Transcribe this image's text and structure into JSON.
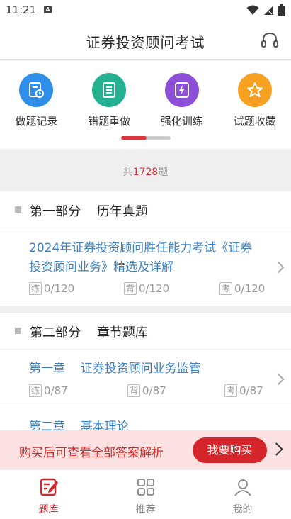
{
  "status": {
    "time": "11:21",
    "notif_icon": "a-notification-icon"
  },
  "header": {
    "title": "证券投资顾问考试",
    "right_icon": "headset-icon"
  },
  "features": [
    {
      "label": "做题记录",
      "icon": "record-icon",
      "color": "#2f8fe8"
    },
    {
      "label": "错题重做",
      "icon": "list-icon",
      "color": "#24b192"
    },
    {
      "label": "强化训练",
      "icon": "lightning-icon",
      "color": "#8e4fd8"
    },
    {
      "label": "试题收藏",
      "icon": "star-icon",
      "color": "#f7a122"
    }
  ],
  "total": {
    "prefix": "共",
    "count": "1728",
    "suffix": "题"
  },
  "sections": [
    {
      "title": "第一部分    历年真题",
      "items": [
        {
          "title": "2024年证券投资顾问胜任能力考试《证券\n投资顾问业务》精选及详解",
          "stats": [
            {
              "tag": "练",
              "value": "0/120"
            },
            {
              "tag": "背",
              "value": "0/120"
            },
            {
              "tag": "考",
              "value": "0/120"
            }
          ]
        }
      ]
    },
    {
      "title": "第二部分    章节题库",
      "items": [
        {
          "title": "第一章    证券投资顾问业务监管",
          "stats": [
            {
              "tag": "练",
              "value": "0/87"
            },
            {
              "tag": "背",
              "value": "0/87"
            },
            {
              "tag": "考",
              "value": "0/87"
            }
          ]
        },
        {
          "title": "第二章    基本理论"
        }
      ]
    }
  ],
  "banner": {
    "text": "购买后可查看全部答案解析",
    "button": "我要购买"
  },
  "tabs": [
    {
      "label": "题库",
      "icon": "question-bank-icon",
      "active": true
    },
    {
      "label": "推荐",
      "icon": "grid-icon",
      "active": false
    },
    {
      "label": "我的",
      "icon": "profile-icon",
      "active": false
    }
  ],
  "colors": {
    "accent": "#d6252a",
    "link": "#3a7fc4",
    "banner_bg": "#fbe1e1"
  }
}
